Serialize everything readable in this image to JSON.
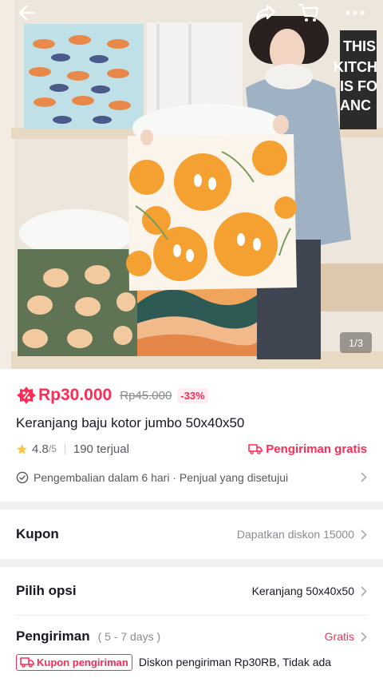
{
  "gallery": {
    "counter": "1/3",
    "photo_sign_text": [
      "THIS",
      "KITCH",
      "IS FO",
      "ANC"
    ]
  },
  "topbar": {
    "back_icon": "arrow-left-icon",
    "share_icon": "share-icon",
    "cart_icon": "cart-icon",
    "more_icon": "more-icon"
  },
  "product": {
    "price": "Rp30.000",
    "original_price": "Rp45.000",
    "discount": "-33%",
    "title": "Keranjang baju kotor jumbo 50x40x50",
    "rating": "4.8",
    "rating_max": "/5",
    "sold": "190 terjual",
    "free_shipping": "Pengiriman gratis",
    "return_policy": "Pengembalian dalam 6 hari · Penjual yang disetujui"
  },
  "coupon": {
    "label": "Kupon",
    "value": "Dapatkan diskon 15000"
  },
  "options": {
    "label": "Pilih opsi",
    "value": "Keranjang 50x40x50"
  },
  "shipping": {
    "label": "Pengiriman",
    "days": "( 5 - 7 days )",
    "value": "Gratis",
    "coupon_badge": "Kupon pengiriman",
    "coupon_desc": "Diskon pengiriman Rp30RB, Tidak ada"
  },
  "colors": {
    "accent": "#fe2c55",
    "text": "#161823",
    "muted": "#8a8b91",
    "background": "#f1f1f2"
  }
}
